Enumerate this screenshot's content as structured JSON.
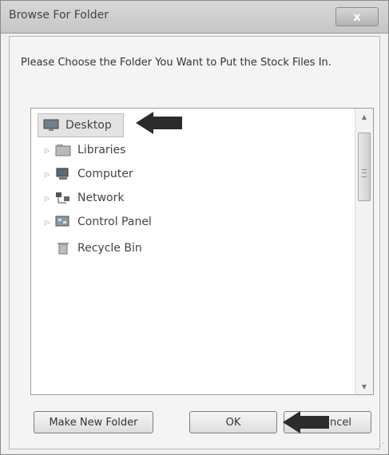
{
  "window": {
    "title": "Browse For Folder",
    "close_glyph": "x"
  },
  "prompt": "Please Choose the Folder You Want to Put the Stock Files In.",
  "tree": {
    "items": [
      {
        "label": "Desktop",
        "icon": "desktop-icon",
        "expandable": false,
        "selected": true
      },
      {
        "label": "Libraries",
        "icon": "libraries-icon",
        "expandable": true,
        "selected": false
      },
      {
        "label": "Computer",
        "icon": "computer-icon",
        "expandable": true,
        "selected": false
      },
      {
        "label": "Network",
        "icon": "network-icon",
        "expandable": true,
        "selected": false
      },
      {
        "label": "Control Panel",
        "icon": "control-panel-icon",
        "expandable": true,
        "selected": false
      },
      {
        "label": "Recycle Bin",
        "icon": "recycle-bin-icon",
        "expandable": false,
        "selected": false
      }
    ],
    "expander_glyph": "▷"
  },
  "scrollbar": {
    "up_glyph": "▲",
    "down_glyph": "▼"
  },
  "buttons": {
    "make_new_folder": "Make New Folder",
    "ok": "OK",
    "cancel": "Cancel"
  },
  "colors": {
    "arrow": "#2c2c2c",
    "background": "#f0f0f0"
  }
}
